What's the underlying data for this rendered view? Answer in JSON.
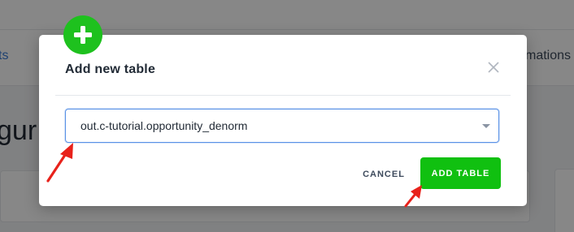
{
  "background": {
    "tab_left_text": "ts",
    "tab_right_text": "mations",
    "heading_text": "gur"
  },
  "modal": {
    "title": "Add new table",
    "add_icon": "plus-icon",
    "close_icon": "close-icon",
    "table_select": {
      "selected_value": "out.c-tutorial.opportunity_denorm",
      "caret_icon": "caret-down-icon"
    },
    "cancel_label": "CANCEL",
    "add_table_label": "ADD TABLE"
  },
  "annotations": {
    "arrow_color": "#e8221b",
    "count": 2
  },
  "colors": {
    "primary_green": "#10c010",
    "badge_green": "#1ec11e",
    "focus_blue": "#5a92e6",
    "link_blue": "#3a7bd5"
  }
}
